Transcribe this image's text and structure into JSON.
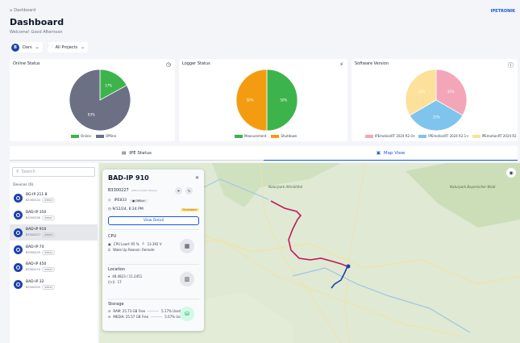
{
  "header": {
    "breadcrumb": "Dashboard",
    "brand": "IPETRONIK",
    "title": "Dashboard",
    "welcome": "Welcome! Good Afternoon",
    "user_initial": "B",
    "user_filter": "Dars",
    "project_filter": "All Projects"
  },
  "cards": {
    "online": {
      "title": "Online Status",
      "slices": [
        {
          "label": "17%",
          "value": 17,
          "color": "#3cb44b"
        },
        {
          "label": "83%",
          "value": 83,
          "color": "#6b7084"
        }
      ],
      "legend": [
        "Online",
        "Offline"
      ]
    },
    "logger": {
      "title": "Logger Status",
      "slices": [
        {
          "label": "50%",
          "value": 50,
          "color": "#3cb44b"
        },
        {
          "label": "50%",
          "value": 50,
          "color": "#f39c12"
        }
      ],
      "legend": [
        "Measurement",
        "Shutdown"
      ]
    },
    "software": {
      "title": "Software Version",
      "slices": [
        {
          "label": "33%",
          "value": 33.3,
          "color": "#f4a6b9"
        },
        {
          "label": "33%",
          "value": 33.3,
          "color": "#7fc4ec"
        },
        {
          "label": "33%",
          "value": 33.4,
          "color": "#fde09a"
        }
      ],
      "legend": [
        "IPEmotionRT 2024 R2.0+",
        "IPEmotionRT 2024 R2.1+",
        "IPEmotionRT 2024 R2"
      ]
    }
  },
  "tabs": {
    "status": "IPE Status",
    "map": "Map View"
  },
  "sidebar": {
    "search_placeholder": "Search",
    "devices_heading": "Devices (6)",
    "devices": [
      {
        "name": "BG-IP 211 8",
        "serial": "B3300224",
        "tag": "IPE833"
      },
      {
        "name": "BAD-IP 350",
        "serial": "B3300256",
        "tag": "IPE5kF"
      },
      {
        "name": "BAD-IP 910",
        "serial": "B3300227",
        "tag": "IPE833"
      },
      {
        "name": "BAD-IP 74",
        "serial": "B3300225",
        "tag": "IPE833"
      },
      {
        "name": "BAD-IP 450",
        "serial": "B3300210",
        "tag": "IPE833"
      },
      {
        "name": "BAD-IP 32",
        "serial": "B3300205",
        "tag": "IPE833"
      }
    ]
  },
  "popup": {
    "title": "BAD-IP 910",
    "serial": "B3300227",
    "serial_note": "(Afteroma/pit datype)",
    "model": "IPE833",
    "status": "Offline",
    "timestamp": "9/12/24, 6:24 PM",
    "state": "Shutdown",
    "view_detail": "View Detail",
    "cpu": {
      "title": "CPU",
      "load": "CPU Load: 95 %",
      "temp": "13.392 V",
      "wake": "Wake Up Reason: Remote"
    },
    "location": {
      "title": "Location",
      "coords": "48.4823 / 11.2451",
      "signal": "17"
    },
    "storage": {
      "title": "Storage",
      "ram": "RAM: 25.73 GB Free",
      "ram_used": "5.17% Used",
      "media": "MEDIA: 25.57 GB Free",
      "media_used": "5.07% Used"
    }
  },
  "map_labels": [
    "Naturpark Altmühltal",
    "Naturpark Bayerischer Wald"
  ]
}
